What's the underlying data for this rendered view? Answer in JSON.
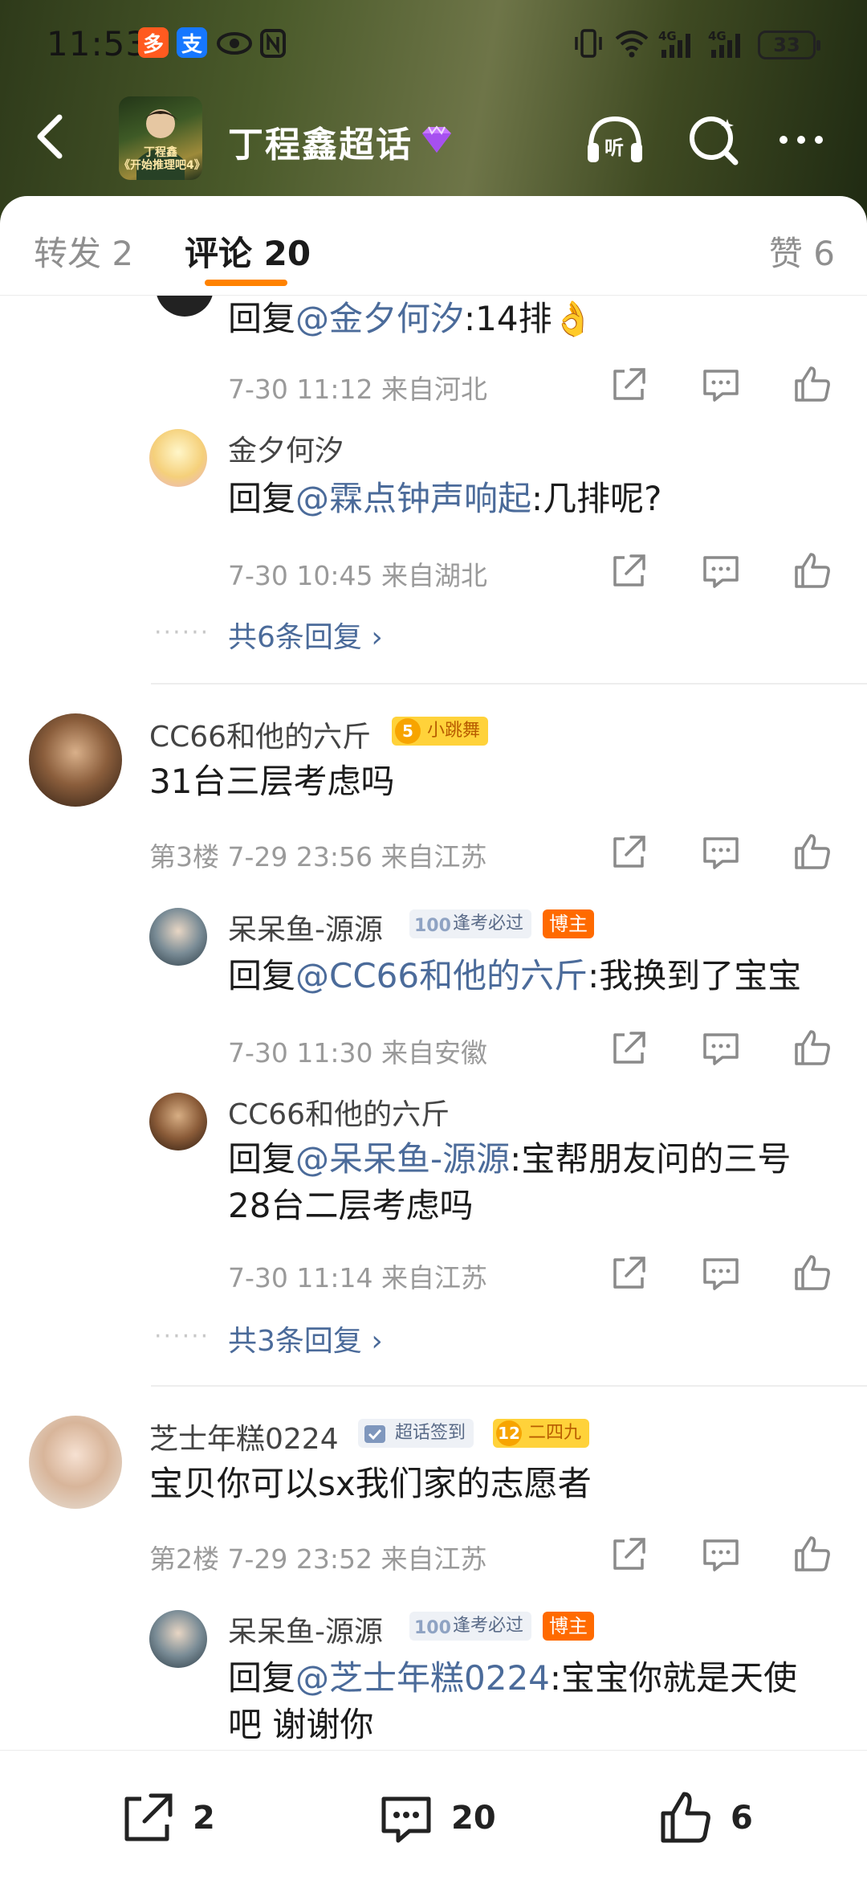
{
  "status_bar": {
    "time": "11:53",
    "battery": "33",
    "app_icon_1": "多",
    "app_icon_2": "支"
  },
  "header": {
    "title": "丁程鑫超话",
    "avatar_caption_line1": "丁程鑫",
    "avatar_caption_line2": "《开始推理吧4》",
    "listen_label": "听"
  },
  "tabs": [
    {
      "label": "转发 2"
    },
    {
      "label": "评论 20"
    },
    {
      "label": "赞 6"
    }
  ],
  "comments": {
    "top_partial": {
      "reply_prefix": "回复",
      "mention": "@金夕何汐",
      "text": ":14排👌",
      "meta": "7-30 11:12  来自河北"
    },
    "reply_a": {
      "name": "金夕何汐",
      "reply_prefix": "回复",
      "mention": "@霖点钟声响起",
      "text": ":几排呢?",
      "meta": "7-30 10:45  来自湖北"
    },
    "more_replies_1": "共6条回复 ›",
    "c3": {
      "name": "CC66和他的六斤",
      "badge_level": "5",
      "badge_text": "小跳舞",
      "text": "31台三层考虑吗",
      "meta": "第3楼  7-29 23:56  来自江苏"
    },
    "reply_b": {
      "name": "呆呆鱼-源源",
      "badge_icon": "100",
      "badge_text": "逢考必过",
      "role": "博主",
      "reply_prefix": "回复",
      "mention": "@CC66和他的六斤",
      "text": ":我换到了宝宝",
      "meta": "7-30 11:30  来自安徽"
    },
    "reply_c": {
      "name": "CC66和他的六斤",
      "reply_prefix": "回复",
      "mention": "@呆呆鱼-源源",
      "text_line1": ":宝帮朋友问的三号",
      "text_line2": "28台二层考虑吗",
      "meta": "7-30 11:14  来自江苏"
    },
    "more_replies_2": "共3条回复 ›",
    "c2": {
      "name": "芝士年糕0224",
      "badge1_text": "超话签到",
      "badge2_level": "12",
      "badge2_text": "二四九",
      "text": "宝贝你可以sx我们家的志愿者",
      "meta": "第2楼  7-29 23:52  来自江苏"
    },
    "reply_d": {
      "name": "呆呆鱼-源源",
      "badge_icon": "100",
      "badge_text": "逢考必过",
      "role": "博主",
      "reply_prefix": "回复",
      "mention": "@芝士年糕0224",
      "text_line1": ":宝宝你就是天使",
      "text_line2": "吧 谢谢你"
    },
    "dots": "······"
  },
  "bottom_bar": {
    "repost_count": "2",
    "comment_count": "20",
    "like_count": "6"
  },
  "colors": {
    "accent": "#ff8200",
    "mention": "#4b6b9a",
    "header_bg": "#4a5a2a"
  }
}
